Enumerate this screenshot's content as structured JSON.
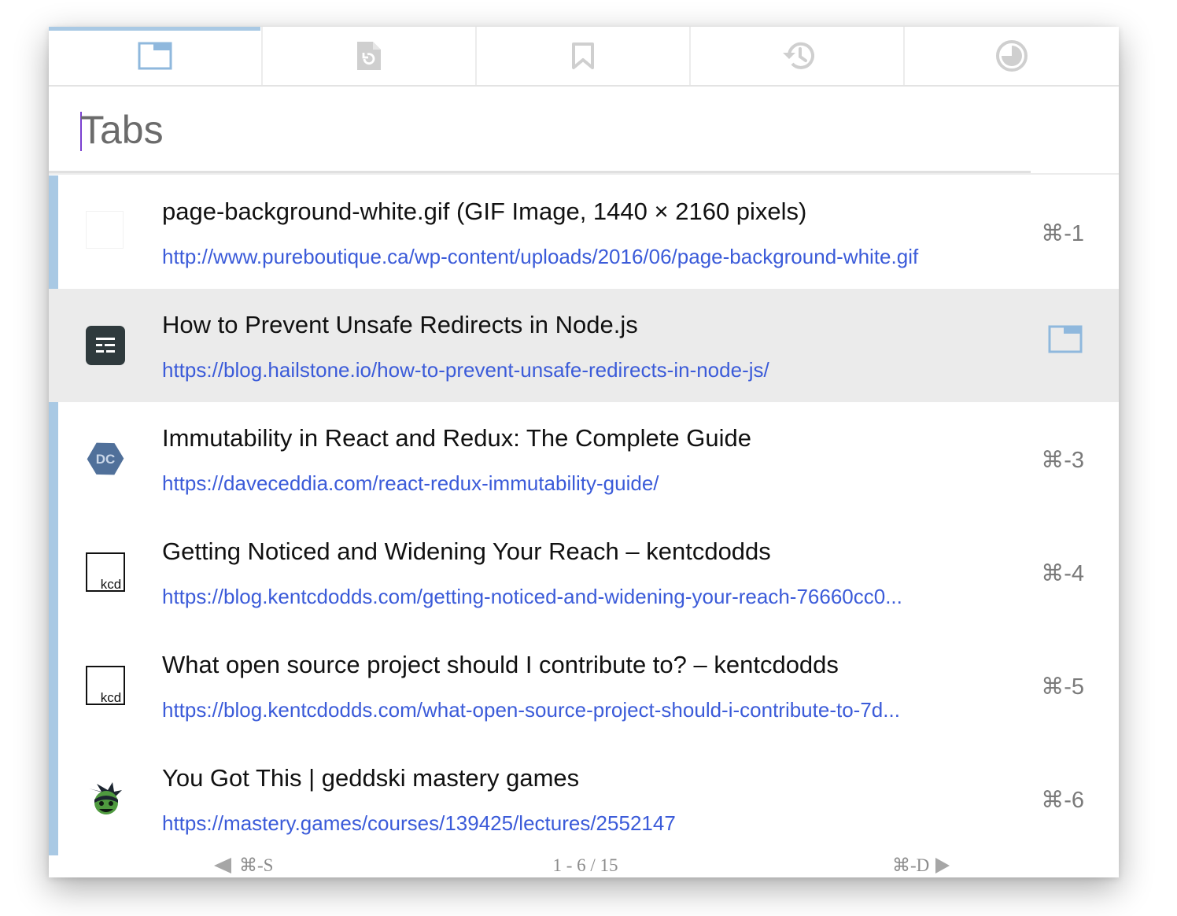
{
  "tabbar": {
    "buttons": [
      {
        "icon": "tabs-icon",
        "active": true
      },
      {
        "icon": "recently-closed-icon",
        "active": false
      },
      {
        "icon": "bookmark-icon",
        "active": false
      },
      {
        "icon": "history-icon",
        "active": false
      },
      {
        "icon": "top-sites-icon",
        "active": false
      }
    ]
  },
  "search": {
    "placeholder": "Tabs",
    "value": ""
  },
  "items": [
    {
      "title": "page-background-white.gif (GIF Image, 1440 × 2160 pixels)",
      "url": "http://www.pureboutique.ca/wp-content/uploads/2016/06/page-background-white.gif",
      "shortcut": "⌘-1",
      "favicon": "blank-favicon"
    },
    {
      "title": "How to Prevent Unsafe Redirects in Node.js",
      "url": "https://blog.hailstone.io/how-to-prevent-unsafe-redirects-in-node-js/",
      "shortcut": "",
      "favicon": "hailstone-favicon",
      "selected": true,
      "action_icon": "switch-to-tab-icon"
    },
    {
      "title": "Immutability in React and Redux: The Complete Guide",
      "url": "https://daveceddia.com/react-redux-immutability-guide/",
      "shortcut": "⌘-3",
      "favicon": "daveceddia-favicon",
      "favicon_text": "DC"
    },
    {
      "title": "Getting Noticed and Widening Your Reach – kentcdodds",
      "url": "https://blog.kentcdodds.com/getting-noticed-and-widening-your-reach-76660cc0...",
      "shortcut": "⌘-4",
      "favicon": "kcd-favicon",
      "favicon_text": "kcd"
    },
    {
      "title": "What open source project should I contribute to? – kentcdodds",
      "url": "https://blog.kentcdodds.com/what-open-source-project-should-i-contribute-to-7d...",
      "shortcut": "⌘-5",
      "favicon": "kcd-favicon",
      "favicon_text": "kcd"
    },
    {
      "title": "You Got This | geddski mastery games",
      "url": "https://mastery.games/courses/139425/lectures/2552147",
      "shortcut": "⌘-6",
      "favicon": "mastery-games-favicon"
    }
  ],
  "footer": {
    "prev_shortcut": "⌘-S",
    "page_count": "1 - 6 / 15",
    "next_shortcut": "⌘-D"
  },
  "colors": {
    "accent": "#a9c9e4",
    "link": "#3b5bd9",
    "selected_row": "#ebebeb"
  }
}
